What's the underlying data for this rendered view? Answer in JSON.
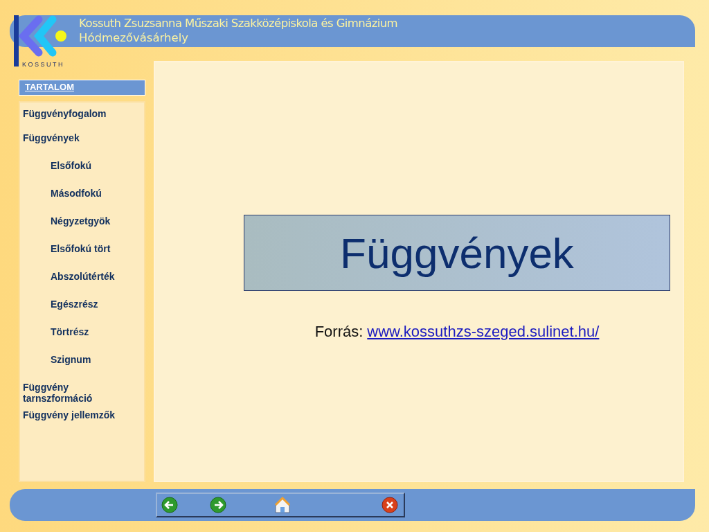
{
  "header": {
    "logo_text": "KOSSUTH",
    "title": "Kossuth Zsuzsanna Műszaki Szakközépiskola és Gimnázium",
    "subtitle": "Hódmezővásárhely"
  },
  "sidebar": {
    "heading": "TARTALOM",
    "items": [
      {
        "label": "Függvényfogalom"
      },
      {
        "label": "Függvények",
        "children": [
          {
            "label": "Elsőfokú"
          },
          {
            "label": "Másodfokú"
          },
          {
            "label": "Négyzetgyök"
          },
          {
            "label": "Elsőfokú tört"
          },
          {
            "label": "Abszolútérték"
          },
          {
            "label": "Egészrész"
          },
          {
            "label": "Törtrész"
          },
          {
            "label": "Szignum"
          }
        ]
      },
      {
        "label": "Függvény tarnszformáció"
      },
      {
        "label": "Függvény jellemzők"
      }
    ]
  },
  "main": {
    "title": "Függvények",
    "source_label": "Forrás:",
    "source_link": "www.kossuthzs-szeged.sulinet.hu/"
  }
}
